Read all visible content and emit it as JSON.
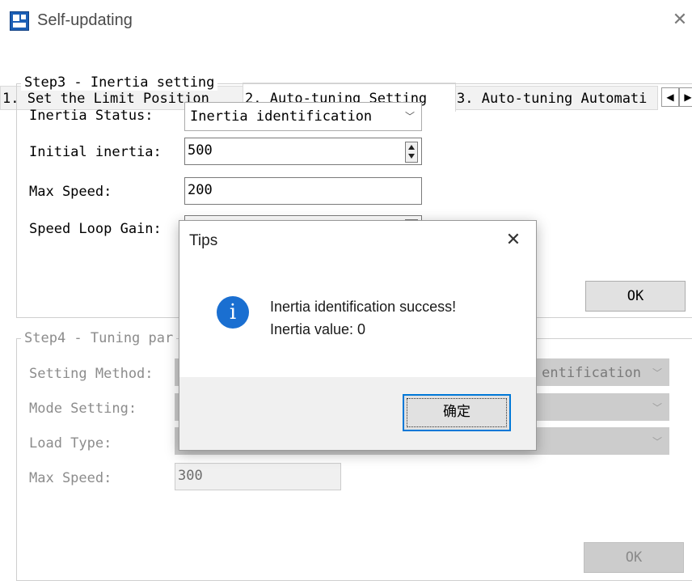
{
  "window": {
    "title": "Self-updating",
    "close_glyph": "✕",
    "icon": "app-logo-icon"
  },
  "tabs": [
    {
      "label": "1. Set the Limit Position",
      "active": false
    },
    {
      "label": "2. Auto-tuning Setting",
      "active": true
    },
    {
      "label": "3. Auto-tuning Automati",
      "active": false
    }
  ],
  "tab_scroll": {
    "left_glyph": "◀",
    "right_glyph": "▶"
  },
  "step3": {
    "legend": "Step3 - Inertia setting",
    "inertia_status_label": "Inertia Status:",
    "inertia_status_value": "Inertia identification",
    "initial_inertia_label": "Initial inertia:",
    "initial_inertia_value": "500",
    "max_speed_label": "Max Speed:",
    "max_speed_value": "200",
    "speed_loop_gain_label": "Speed Loop Gain:",
    "ok_label": "OK"
  },
  "step4": {
    "legend": "Step4 - Tuning par",
    "setting_method_label": "Setting Method:",
    "setting_method_value_visible": "entification",
    "mode_setting_label": "Mode Setting:",
    "load_type_label": "Load Type:",
    "max_speed_label": "Max Speed:",
    "max_speed_value": "300",
    "ok_label": "OK"
  },
  "dialog": {
    "title": "Tips",
    "close_glyph": "✕",
    "icon": "info-icon",
    "icon_glyph": "i",
    "message_line1": "Inertia identification success!",
    "message_line2": "Inertia value: 0",
    "confirm_label": "确定"
  },
  "colors": {
    "accent": "#0078d7",
    "info_icon": "#1a6fd1",
    "disabled_fill": "#cccccc"
  }
}
